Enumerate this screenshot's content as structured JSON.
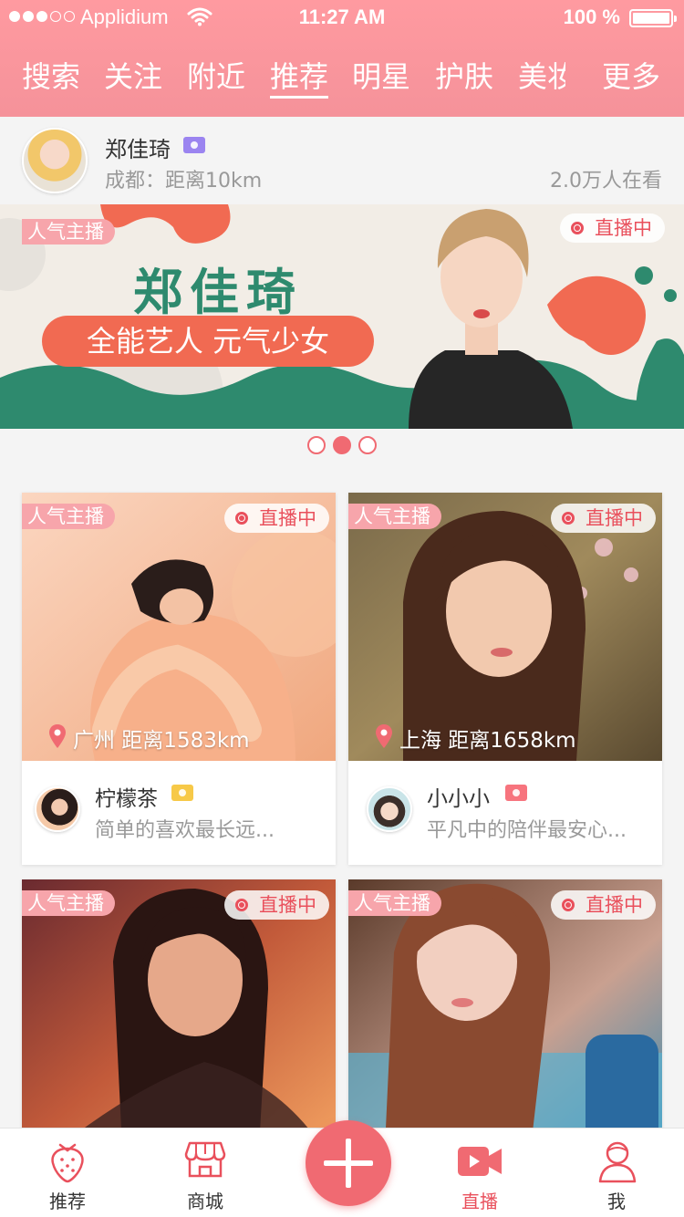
{
  "status_bar": {
    "carrier": "Applidium",
    "time": "11:27 AM",
    "battery": "100 %"
  },
  "nav": {
    "items": [
      {
        "label": "搜索",
        "active": false
      },
      {
        "label": "关注",
        "active": false
      },
      {
        "label": "附近",
        "active": false
      },
      {
        "label": "推荐",
        "active": true
      },
      {
        "label": "明星",
        "active": false
      },
      {
        "label": "护肤",
        "active": false
      },
      {
        "label": "美妆",
        "active": false
      },
      {
        "label": "更多",
        "active": false
      }
    ]
  },
  "featured": {
    "name": "郑佳琦",
    "location": "成都：距离10km",
    "watching": "2.0万人在看",
    "badge_color": "#9b84f0"
  },
  "banner": {
    "tag": "人气主播",
    "live": "直播中",
    "title": "郑佳琦",
    "slogan": "全能艺人 元气少女",
    "pager": {
      "count": 3,
      "active_index": 1
    }
  },
  "cards": [
    {
      "tag": "人气主播",
      "live": "直播中",
      "location": "广州 距离1583km",
      "name": "柠檬茶",
      "desc": "简单的喜欢最长远...",
      "badge_color": "#f7c948"
    },
    {
      "tag": "人气主播",
      "live": "直播中",
      "location": "上海 距离1658km",
      "name": "小小小",
      "desc": "平凡中的陪伴最安心...",
      "badge_color": "#f7747e"
    },
    {
      "tag": "人气主播",
      "live": "直播中"
    },
    {
      "tag": "人气主播",
      "live": "直播中"
    }
  ],
  "tabbar": {
    "items": [
      {
        "label": "推荐",
        "icon": "strawberry-icon",
        "active": false
      },
      {
        "label": "商城",
        "icon": "shop-icon",
        "active": false
      },
      {
        "label": "直播",
        "icon": "video-camera-icon",
        "active": true
      },
      {
        "label": "我",
        "icon": "person-icon",
        "active": false
      }
    ],
    "center_icon": "plus-icon"
  },
  "colors": {
    "header": "#f5929a",
    "accent": "#f06a72",
    "live_red": "#e9505c",
    "banner_green": "#2e8a6e",
    "banner_orange": "#f16a52"
  }
}
